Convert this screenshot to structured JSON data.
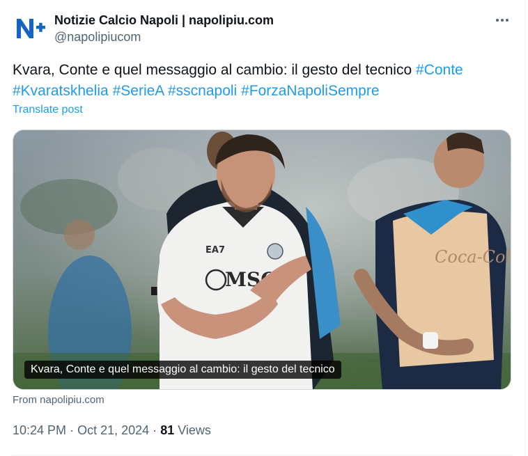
{
  "author": {
    "display_name": "Notizie Calcio Napoli | napolipiu.com",
    "handle": "@napolipiucom",
    "avatar_text": "N+",
    "accent_color": "#1565c0"
  },
  "post": {
    "text": "Kvara, Conte e quel messaggio al cambio: il gesto del tecnico",
    "hashtags": [
      "#Conte",
      "#Kvaratskhelia",
      "#SerieA",
      "#sscnapoli",
      "#ForzaNapoliSempre"
    ],
    "translate_label": "Translate post"
  },
  "media": {
    "caption": "Kvara, Conte e quel messaggio al cambio: il gesto del tecnico",
    "jersey_sponsor": "MSC",
    "jersey_brand": "EA7",
    "bib_text": "Coca-Cola",
    "source": "From napolipiu.com"
  },
  "meta": {
    "time": "10:24 PM",
    "separator": "·",
    "date": "Oct 21, 2024",
    "views_count": "81",
    "views_label": "Views"
  },
  "colors": {
    "link": "#1d9bf0",
    "muted": "#536471",
    "text": "#0f1419"
  }
}
